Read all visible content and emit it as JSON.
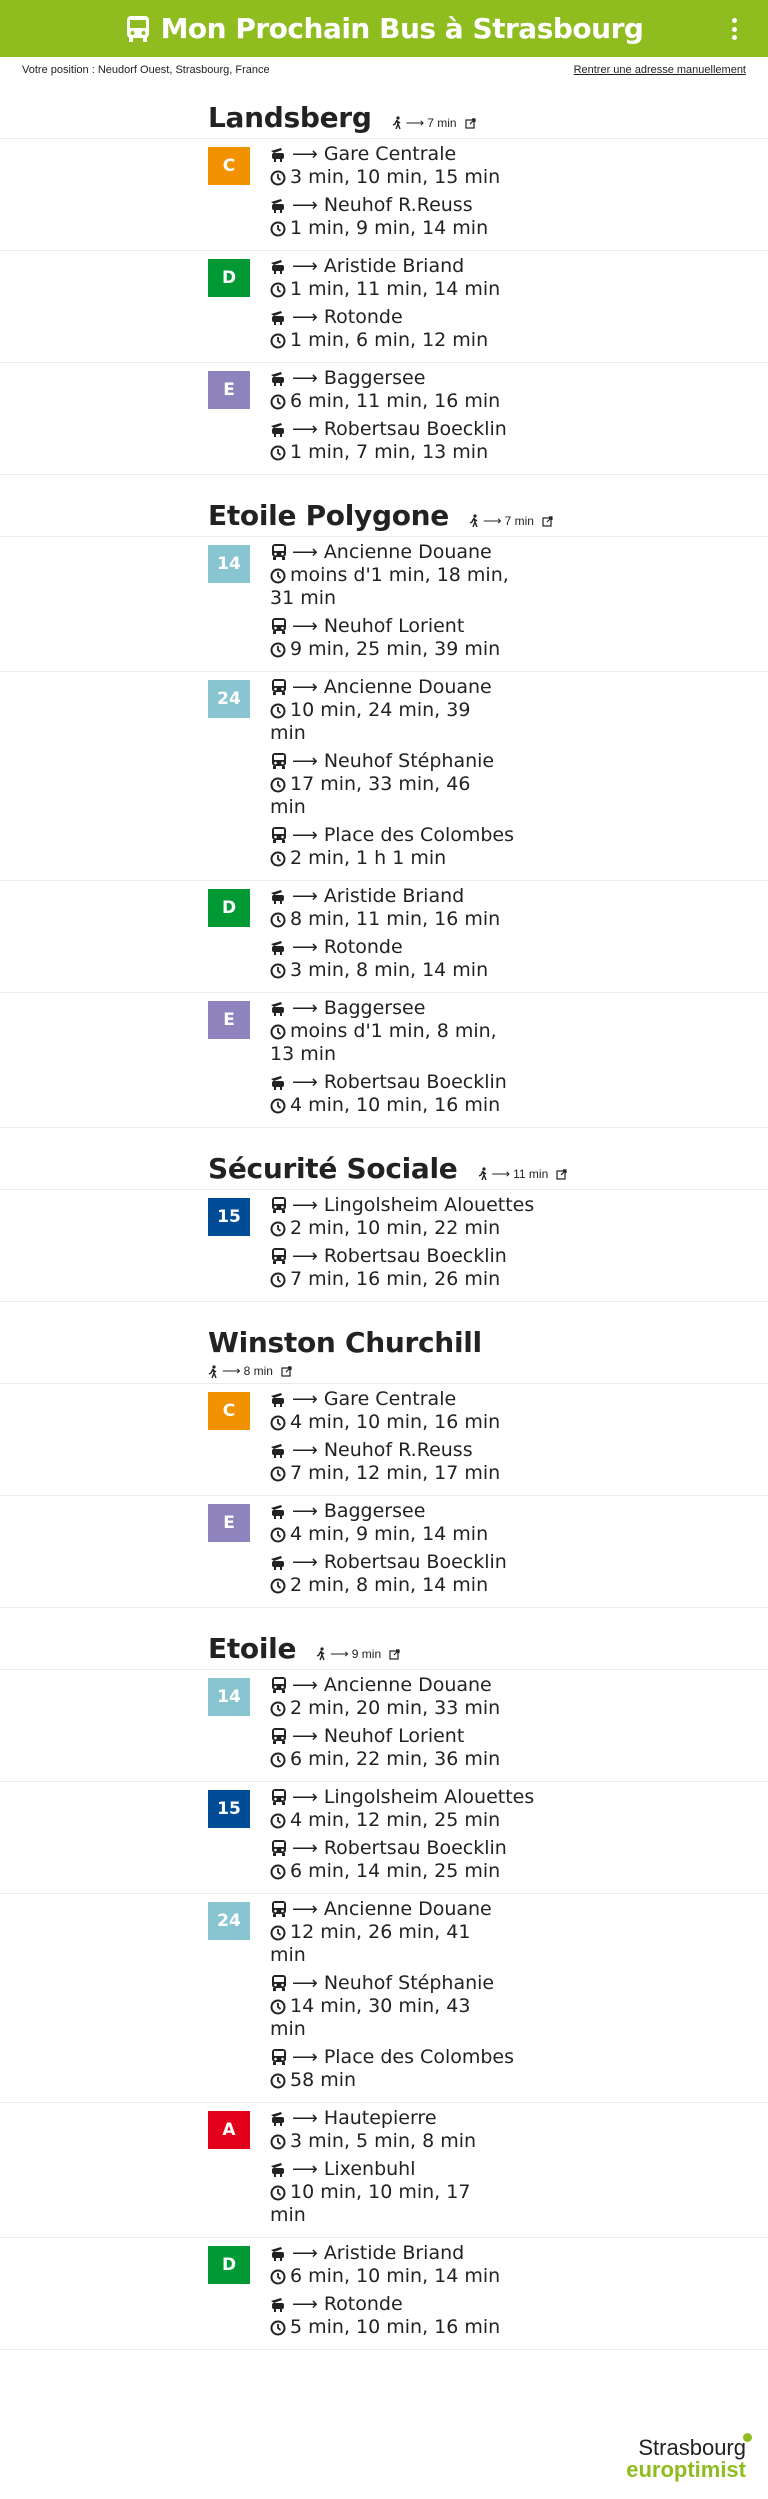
{
  "header": {
    "title": "Mon Prochain Bus à Strasbourg"
  },
  "location": {
    "position": "Votre position : Neudorf Ouest, Strasbourg, France",
    "manual_link": "Rentrer une adresse manuellement"
  },
  "stations": [
    {
      "name": "Landsberg",
      "walk": "7 min",
      "walk_block": false,
      "lines": [
        {
          "id": "C",
          "color": "#f39200",
          "mode": "tram",
          "directions": [
            {
              "dest": "Gare Centrale",
              "times": "3 min, 10 min, 15 min"
            },
            {
              "dest": "Neuhof R.Reuss",
              "times": "1 min, 9 min, 14 min"
            }
          ]
        },
        {
          "id": "D",
          "color": "#009933",
          "mode": "tram",
          "directions": [
            {
              "dest": "Aristide Briand",
              "times": "1 min, 11 min, 14 min"
            },
            {
              "dest": "Rotonde",
              "times": "1 min, 6 min, 12 min"
            }
          ]
        },
        {
          "id": "E",
          "color": "#8e83bd",
          "mode": "tram",
          "directions": [
            {
              "dest": "Baggersee",
              "times": "6 min, 11 min, 16 min"
            },
            {
              "dest": "Robertsau Boecklin",
              "times": "1 min, 7 min, 13 min"
            }
          ]
        }
      ]
    },
    {
      "name": "Etoile Polygone",
      "walk": "7 min",
      "walk_block": false,
      "lines": [
        {
          "id": "14",
          "color": "#89c5d0",
          "mode": "bus",
          "directions": [
            {
              "dest": "Ancienne Douane",
              "times": "moins d'1 min, 18 min, 31 min"
            },
            {
              "dest": "Neuhof Lorient",
              "times": "9 min, 25 min, 39 min"
            }
          ]
        },
        {
          "id": "24",
          "color": "#89c5d0",
          "mode": "bus",
          "directions": [
            {
              "dest": "Ancienne Douane",
              "times": "10 min, 24 min, 39 min"
            },
            {
              "dest": "Neuhof Stéphanie",
              "times": "17 min, 33 min, 46 min"
            },
            {
              "dest": "Place des Colombes",
              "times": "2 min, 1 h 1 min"
            }
          ]
        },
        {
          "id": "D",
          "color": "#009933",
          "mode": "tram",
          "directions": [
            {
              "dest": "Aristide Briand",
              "times": "8 min, 11 min, 16 min"
            },
            {
              "dest": "Rotonde",
              "times": "3 min, 8 min, 14 min"
            }
          ]
        },
        {
          "id": "E",
          "color": "#8e83bd",
          "mode": "tram",
          "directions": [
            {
              "dest": "Baggersee",
              "times": "moins d'1 min, 8 min, 13 min"
            },
            {
              "dest": "Robertsau Boecklin",
              "times": "4 min, 10 min, 16 min"
            }
          ]
        }
      ]
    },
    {
      "name": "Sécurité Sociale",
      "walk": "11 min",
      "walk_block": false,
      "lines": [
        {
          "id": "15",
          "color": "#004c97",
          "mode": "bus",
          "directions": [
            {
              "dest": "Lingolsheim Alouettes",
              "times": "2 min, 10 min, 22 min"
            },
            {
              "dest": "Robertsau Boecklin",
              "times": "7 min, 16 min, 26 min"
            }
          ]
        }
      ]
    },
    {
      "name": "Winston Churchill",
      "walk": "8 min",
      "walk_block": true,
      "lines": [
        {
          "id": "C",
          "color": "#f39200",
          "mode": "tram",
          "directions": [
            {
              "dest": "Gare Centrale",
              "times": "4 min, 10 min, 16 min"
            },
            {
              "dest": "Neuhof R.Reuss",
              "times": "7 min, 12 min, 17 min"
            }
          ]
        },
        {
          "id": "E",
          "color": "#8e83bd",
          "mode": "tram",
          "directions": [
            {
              "dest": "Baggersee",
              "times": "4 min, 9 min, 14 min"
            },
            {
              "dest": "Robertsau Boecklin",
              "times": "2 min, 8 min, 14 min"
            }
          ]
        }
      ]
    },
    {
      "name": "Etoile",
      "walk": "9 min",
      "walk_block": false,
      "lines": [
        {
          "id": "14",
          "color": "#89c5d0",
          "mode": "bus",
          "directions": [
            {
              "dest": "Ancienne Douane",
              "times": "2 min, 20 min, 33 min"
            },
            {
              "dest": "Neuhof Lorient",
              "times": "6 min, 22 min, 36 min"
            }
          ]
        },
        {
          "id": "15",
          "color": "#004c97",
          "mode": "bus",
          "directions": [
            {
              "dest": "Lingolsheim Alouettes",
              "times": "4 min, 12 min, 25 min"
            },
            {
              "dest": "Robertsau Boecklin",
              "times": "6 min, 14 min, 25 min"
            }
          ]
        },
        {
          "id": "24",
          "color": "#89c5d0",
          "mode": "bus",
          "directions": [
            {
              "dest": "Ancienne Douane",
              "times": "12 min, 26 min, 41 min"
            },
            {
              "dest": "Neuhof Stéphanie",
              "times": "14 min, 30 min, 43 min"
            },
            {
              "dest": "Place des Colombes",
              "times": "58 min"
            }
          ]
        },
        {
          "id": "A",
          "color": "#e2001a",
          "mode": "tram",
          "directions": [
            {
              "dest": "Hautepierre",
              "times": "3 min, 5 min, 8 min"
            },
            {
              "dest": "Lixenbuhl",
              "times": "10 min, 10 min, 17 min"
            }
          ]
        },
        {
          "id": "D",
          "color": "#009933",
          "mode": "tram",
          "directions": [
            {
              "dest": "Aristide Briand",
              "times": "6 min, 10 min, 14 min"
            },
            {
              "dest": "Rotonde",
              "times": "5 min, 10 min, 16 min"
            }
          ]
        }
      ]
    }
  ],
  "footer": {
    "logo_line1": "Strasbourg",
    "logo_line2": "europtimist"
  },
  "icons": {
    "bus": "bus-icon",
    "tram": "tram-icon",
    "clock": "clock-icon",
    "walk": "walking-icon",
    "external": "external-link-icon",
    "menu": "kebab-menu-icon"
  }
}
